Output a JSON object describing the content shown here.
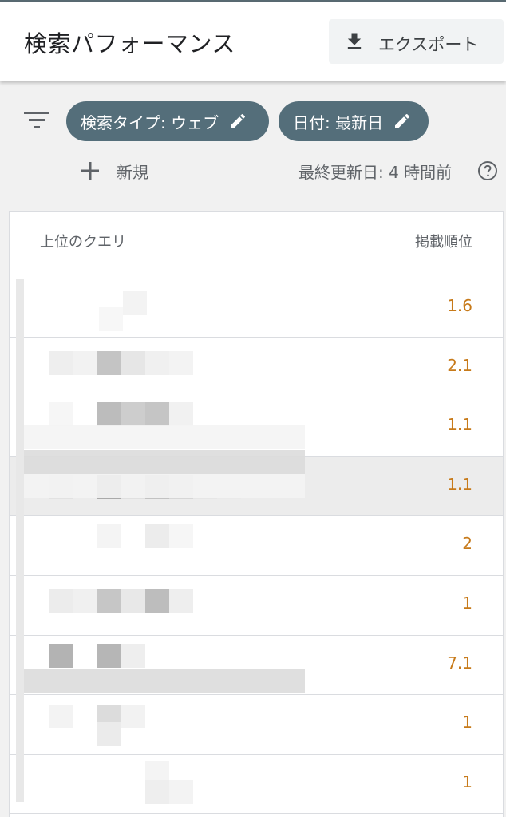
{
  "header": {
    "title": "検索パフォーマンス",
    "export_label": "エクスポート",
    "export_icon": "download-icon"
  },
  "filters": {
    "filter_icon": "filter-list-icon",
    "chips": [
      {
        "label": "検索タイプ: ウェブ",
        "icon": "edit-pencil-icon"
      },
      {
        "label": "日付: 最新日",
        "icon": "edit-pencil-icon"
      }
    ],
    "new_label": "新規",
    "new_icon": "plus-icon",
    "last_updated": "最終更新日: 4 時間前",
    "help_icon": "help-circle-icon"
  },
  "table": {
    "columns": [
      "上位のクエリ",
      "掲載順位"
    ],
    "rows": [
      {
        "query": "",
        "position": "1.6"
      },
      {
        "query": "",
        "position": "2.1"
      },
      {
        "query": "",
        "position": "1.1"
      },
      {
        "query": "",
        "position": "1.1"
      },
      {
        "query": "",
        "position": "2"
      },
      {
        "query": "",
        "position": "1"
      },
      {
        "query": "",
        "position": "7.1"
      },
      {
        "query": "",
        "position": "1"
      },
      {
        "query": "",
        "position": "1"
      }
    ]
  },
  "colors": {
    "chip_bg": "#546e7a",
    "position_value": "#c77a1a",
    "header_bg": "#ffffff",
    "page_bg": "#f1f1f1"
  }
}
